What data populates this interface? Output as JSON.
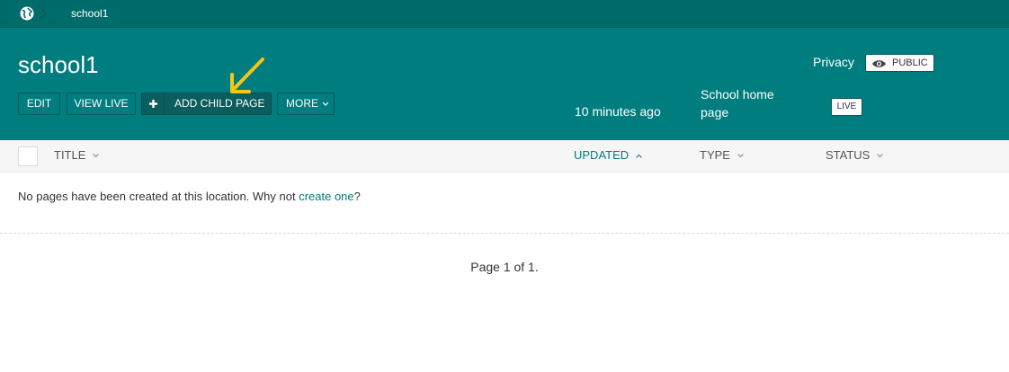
{
  "breadcrumb": {
    "home_icon": "globe-icon",
    "current": "school1"
  },
  "header": {
    "title": "school1",
    "buttons": {
      "edit": "EDIT",
      "view_live": "VIEW LIVE",
      "add_child": "ADD CHILD PAGE",
      "more": "MORE"
    },
    "privacy": {
      "label": "Privacy",
      "badge": "PUBLIC",
      "icon": "eye-icon"
    },
    "updated": "10 minutes ago",
    "type": "School home page",
    "status": "LIVE"
  },
  "annotation": {
    "icon": "arrow-down-left-icon",
    "color": "#f5c518"
  },
  "table": {
    "columns": {
      "title": "TITLE",
      "updated": "UPDATED",
      "type": "TYPE",
      "status": "STATUS"
    }
  },
  "empty": {
    "message": "No pages have been created at this location. Why not ",
    "link": "create one",
    "suffix": "?"
  },
  "pagination": "Page 1 of 1.",
  "colors": {
    "teal": "#007d7e",
    "teal_dark": "#006b6b",
    "button_dark": "#0b5d5e",
    "link": "#007d7e"
  }
}
